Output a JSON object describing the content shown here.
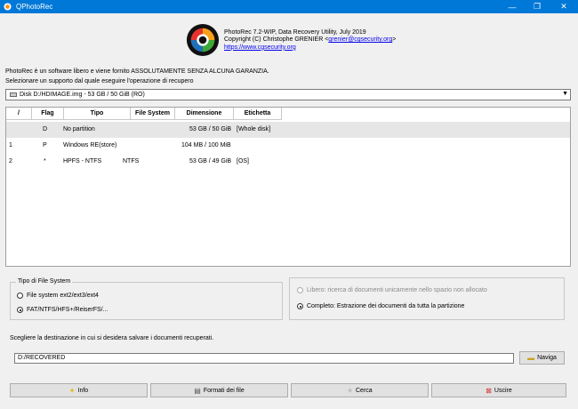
{
  "window": {
    "title": "QPhotoRec",
    "minimize": "—",
    "maximize": "❐",
    "close": "✕"
  },
  "about": {
    "line1": "PhotoRec 7.2-WIP, Data Recovery Utility, July 2019",
    "line2_prefix": "Copyright (C) Christophe GRENIER <",
    "email": "grenier@cgsecurity.org",
    "line2_suffix": ">",
    "website": "https://www.cgsecurity.org"
  },
  "notice": "PhotoRec è un software libero e viene fornito ASSOLUTAMENTE SENZA ALCUNA GARANZIA.",
  "select_prompt": "Selezionare un supporto dal quale eseguire l'operazione di recupero",
  "disk": {
    "selected": "Disk D:/HDIMAGE.img - 53 GB / 50 GiB (RO)"
  },
  "table": {
    "headers": [
      "/",
      "Flag",
      "Tipo",
      "File System",
      "Dimensione",
      "Etichetta"
    ],
    "rows": [
      {
        "num": "",
        "flag": "D",
        "type": "No partition",
        "fs": "",
        "size": "53 GB / 50 GiB",
        "label": "[Whole disk]"
      },
      {
        "num": "1",
        "flag": "P",
        "type": "Windows RE(store)",
        "fs": "",
        "size": "104 MB / 100 MiB",
        "label": ""
      },
      {
        "num": "2",
        "flag": "*",
        "type": "HPFS - NTFS",
        "fs": "NTFS",
        "size": "53 GB / 49 GiB",
        "label": "[OS]"
      }
    ]
  },
  "fs_group": {
    "label": "Tipo di File System",
    "opt1": "File system ext2/ext3/ext4",
    "opt2": "FAT/NTFS/HFS+/ReiserFS/...",
    "selected": 2
  },
  "scope_group": {
    "opt1": "Libero: ricerca di documenti unicamente nello spazio non allocato",
    "opt2": "Completo: Estrazione dei documenti da tutta la partizione",
    "selected": 2
  },
  "destination": {
    "prompt": "Scegliere la destinazione in cui si desidera salvare i documenti recuperati.",
    "value": "D:/RECOVERED",
    "browse": "Naviga"
  },
  "buttons": {
    "info": "Info",
    "formats": "Formati dei file",
    "search": "Cerca",
    "quit": "Uscire"
  }
}
